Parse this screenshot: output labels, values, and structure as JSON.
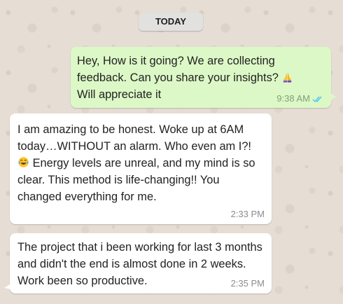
{
  "date_badge": "TODAY",
  "messages": [
    {
      "direction": "outgoing",
      "text_before_emoji": "Hey, How is it going? We are collecting feedback. Can you share your insights?",
      "emoji": "folded-hands-emoji",
      "text_after_emoji": "Will appreciate it",
      "time": "9:38 AM",
      "status": "read",
      "status_color": "#4fc3f7"
    },
    {
      "direction": "incoming",
      "text_before_emoji": "I am amazing to be honest. Woke up at 6AM today…WITHOUT an alarm. Who even am I?!",
      "emoji": "tears-of-joy-emoji",
      "text_after_emoji": "Energy levels are unreal, and my mind is so clear. This method is life-changing!! You changed everything for me.",
      "time": "2:33 PM"
    },
    {
      "direction": "incoming",
      "text": "The project that i been working for last 3 months and didn't the end is almost done in 2 weeks. Work been so productive.",
      "time": "2:35 PM"
    }
  ],
  "colors": {
    "wallpaper": "#e6ddd4",
    "outgoing_bubble": "#dcf8c6",
    "incoming_bubble": "#ffffff",
    "timestamp": "#8c8c8c"
  }
}
